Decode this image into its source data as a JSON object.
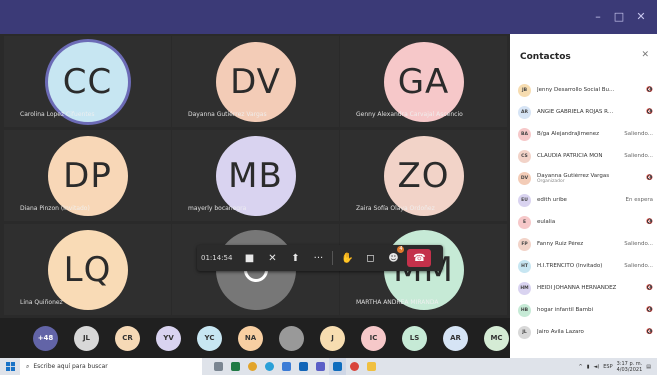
{
  "window": {
    "minimize_icon": "–",
    "maximize_icon": "□",
    "close_icon": "✕"
  },
  "tiles": [
    {
      "initials": "CC",
      "name": "Carolina Lopez Cifuentes",
      "color": "#c7e6f2",
      "active": true
    },
    {
      "initials": "DV",
      "name": "Dayanna Gutiérrez Vargas",
      "color": "#f3ccb7"
    },
    {
      "initials": "GA",
      "name": "Genny Alexandra Carvajal Ascencio",
      "color": "#f6c8c9"
    },
    {
      "initials": "DP",
      "name": "Diana Pinzon (Invitado)",
      "color": "#f8d7b7"
    },
    {
      "initials": "MB",
      "name": "mayerly bocanegra",
      "color": "#d9d3f0"
    },
    {
      "initials": "ZO",
      "name": "Zaira Sofía Olaya Ordoñez",
      "color": "#f2d3c8"
    },
    {
      "initials": "LQ",
      "name": "Lina Quiñonez",
      "color": "#f9dbb6"
    },
    {
      "initials": "",
      "name": "",
      "color": "#777777",
      "grey": true
    },
    {
      "initials": "MM",
      "name": "MARTHA ANDREA MIRANDA",
      "color": "#c6ead6"
    }
  ],
  "toolbar": {
    "timer": "01:14:54",
    "camera_icon": "■",
    "mic_icon": "✕",
    "share_icon": "⬆",
    "more_icon": "···",
    "raise_hand_icon": "✋",
    "chat_icon": "◻",
    "participants_icon": "☻",
    "participants_badge": "4",
    "hangup_icon": "☎"
  },
  "strip": [
    {
      "label": "+48",
      "color": "#6264a7"
    },
    {
      "label": "JL",
      "color": "#d8d8d8"
    },
    {
      "label": "CR",
      "color": "#f6d9b6"
    },
    {
      "label": "YV",
      "color": "#d9d3f0"
    },
    {
      "label": "YC",
      "color": "#c7e6f2"
    },
    {
      "label": "NA",
      "color": "#f8cfa2"
    },
    {
      "label": "",
      "color": "#999999"
    },
    {
      "label": "J",
      "color": "#f7ddb0"
    },
    {
      "label": "IC",
      "color": "#f6c8c9"
    },
    {
      "label": "LS",
      "color": "#c6ead6"
    },
    {
      "label": "AR",
      "color": "#d6e4f5"
    },
    {
      "label": "MC",
      "color": "#d5ecd5"
    }
  ],
  "contacts_panel": {
    "title": "Contactos",
    "close_icon": "✕",
    "contacts": [
      {
        "initials": "JB",
        "name": "Jenny Desarrollo Social Bucara",
        "status": "🔇",
        "color": "#f6dcb0"
      },
      {
        "initials": "AR",
        "name": "ANGIE GABRIELA ROJAS ROD...",
        "status": "🔇",
        "color": "#d6e4f5"
      },
      {
        "initials": "BA",
        "name": "B/ga AlejandraJimenez",
        "status": "Saliendo...",
        "color": "#f6c8c9"
      },
      {
        "initials": "CS",
        "name": "CLAUDIA PATRICIA MON",
        "status": "Saliendo...",
        "color": "#f2d3c8"
      },
      {
        "initials": "DV",
        "name": "Dayanna Gutiérrez Vargas",
        "sub": "Organizador",
        "status": "🔇",
        "color": "#f3ccb7"
      },
      {
        "initials": "EU",
        "name": "edith uribe",
        "status": "En espera",
        "color": "#d9d3f0"
      },
      {
        "initials": "E",
        "name": "eulalia",
        "status": "🔇",
        "color": "#f6c8c9"
      },
      {
        "initials": "FP",
        "name": "Fanny Ruiz Pérez",
        "status": "Saliendo...",
        "color": "#f2d3c8"
      },
      {
        "initials": "HT",
        "name": "H.I.TRENCITO (Invitado)",
        "status": "Saliendo...",
        "color": "#c7e6f2"
      },
      {
        "initials": "HM",
        "name": "HEIDI JOHANNA HERNANDEZ",
        "status": "🔇",
        "color": "#d9d3f0"
      },
      {
        "initials": "HB",
        "name": "hogar infantil Bambi",
        "status": "🔇",
        "color": "#c6ead6"
      },
      {
        "initials": "JL",
        "name": "Jairo Avila Lazaro",
        "status": "🔇",
        "color": "#d8d8d8"
      }
    ]
  },
  "taskbar": {
    "search_placeholder": "Escribe aquí para buscar",
    "clock_time": "3:17 p. m.",
    "clock_date": "4/03/2021",
    "lang": "ESP"
  }
}
